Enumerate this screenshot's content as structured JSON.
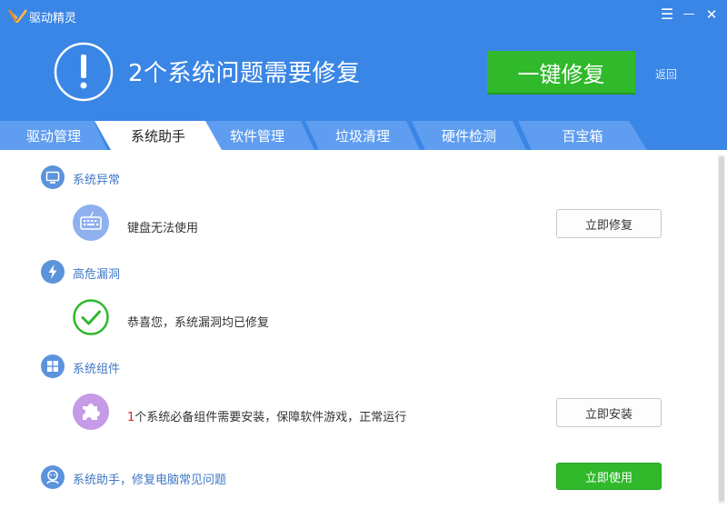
{
  "app": {
    "title": "驱动精灵"
  },
  "window": {
    "menu_glyph": "☰",
    "minimize_glyph": "—",
    "close_glyph": "✕"
  },
  "header": {
    "headline": "2个系统问题需要修复",
    "fix_button": "一键修复",
    "back_link": "返回"
  },
  "tabs": [
    {
      "label": "驱动管理",
      "active": false
    },
    {
      "label": "系统助手",
      "active": true
    },
    {
      "label": "软件管理",
      "active": false
    },
    {
      "label": "垃圾清理",
      "active": false
    },
    {
      "label": "硬件检测",
      "active": false
    },
    {
      "label": "百宝箱",
      "active": false
    }
  ],
  "sections": {
    "abnormal": {
      "title": "系统异常",
      "icon": "monitor-icon",
      "item": {
        "icon": "keyboard-icon",
        "text": "键盘无法使用",
        "button": "立即修复"
      }
    },
    "vulnerability": {
      "title": "高危漏洞",
      "icon": "lightning-icon",
      "item": {
        "icon": "check-icon",
        "text": "恭喜您，系统漏洞均已修复"
      }
    },
    "components": {
      "title": "系统组件",
      "icon": "windows-icon",
      "item": {
        "icon": "puzzle-icon",
        "count": "1",
        "text": "个系统必备组件需要安装，保障软件游戏，正常运行",
        "button": "立即安装"
      }
    },
    "assistant": {
      "title": "系统助手，修复电脑常见问题",
      "icon": "assistant-icon",
      "button": "立即使用"
    }
  },
  "colors": {
    "header_blue": "#3a86e6",
    "accent_green": "#2fb92b",
    "section_blue": "#3f78c6",
    "alert_red": "#e02020"
  }
}
